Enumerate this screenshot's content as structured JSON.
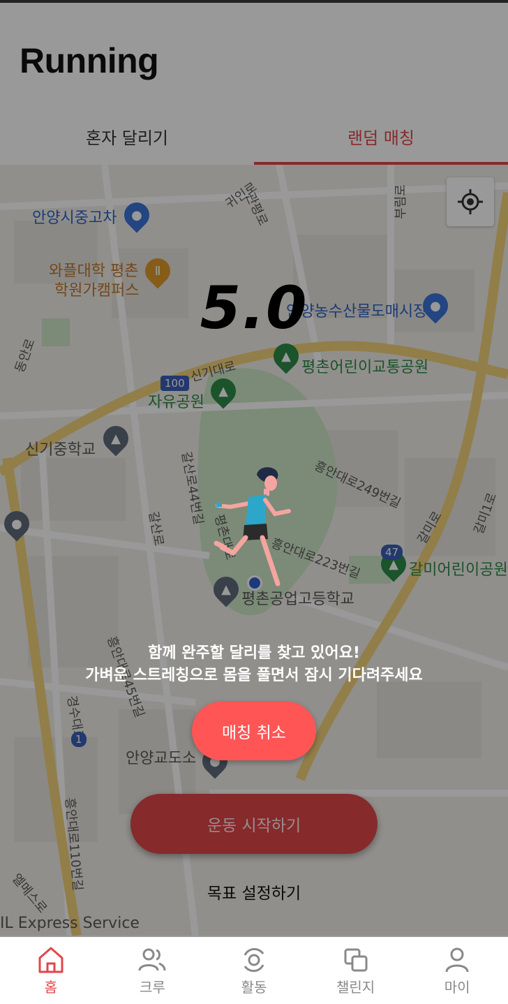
{
  "app": {
    "title": "Running"
  },
  "tabs": [
    {
      "label": "혼자 달리기",
      "active": false
    },
    {
      "label": "랜덤 매칭",
      "active": true
    }
  ],
  "map": {
    "labels": {
      "school_anyang": "안양시중고차",
      "cafe_wapl": "와플대학 평촌",
      "cafe_wapl2": "학원가캠퍼스",
      "market": "안양농수산물도매시장",
      "park_children": "평촌어린이교통공원",
      "park_jayu": "자유공원",
      "school_singi": "신기중학교",
      "road_singi": "신기대로",
      "road_gwiin": "귀인로",
      "road_gwanpyeong": "관평로",
      "road_buim": "부림로",
      "road_dongan": "동안로",
      "road_gangsan44": "갈산로44번길",
      "road_gangsan": "갈산로",
      "road_pyeongchon": "평촌대로",
      "road_heungan249": "흥안대로249번길",
      "road_heungan223": "흥안대로223번길",
      "road_galmi": "갈미로",
      "road_galmi1": "갈미1로",
      "park_galmi": "갈미어린이공원",
      "school_pyeongchon": "평촌공업고등학교",
      "road_gyeongsu": "경수대로",
      "road_heungan45": "흥안대로45번길",
      "library": "안양교도소",
      "road_heungan110": "흥안대로110번길",
      "road_elm": "엘메스로",
      "express": "IL Express Service",
      "shield_100": "100",
      "shield_1": "1",
      "shield_47": "47"
    }
  },
  "matching": {
    "countdown": "5.0",
    "message_line1": "함께 완주할 달리를 찾고 있어요!",
    "message_line2": "가벼운 스트레칭으로 몸을 풀면서 잠시 기다려주세요",
    "cancel_label": "매칭 취소"
  },
  "actions": {
    "start_label": "운동 시작하기",
    "goal_label": "목표 설정하기"
  },
  "bottom_nav": [
    {
      "label": "홈",
      "icon": "home-icon",
      "active": true
    },
    {
      "label": "크루",
      "icon": "people-icon",
      "active": false
    },
    {
      "label": "활동",
      "icon": "activity-icon",
      "active": false
    },
    {
      "label": "챌린지",
      "icon": "challenge-icon",
      "active": false
    },
    {
      "label": "마이",
      "icon": "person-icon",
      "active": false
    }
  ],
  "colors": {
    "accent": "#e0464a",
    "cancel": "#ff5555"
  }
}
